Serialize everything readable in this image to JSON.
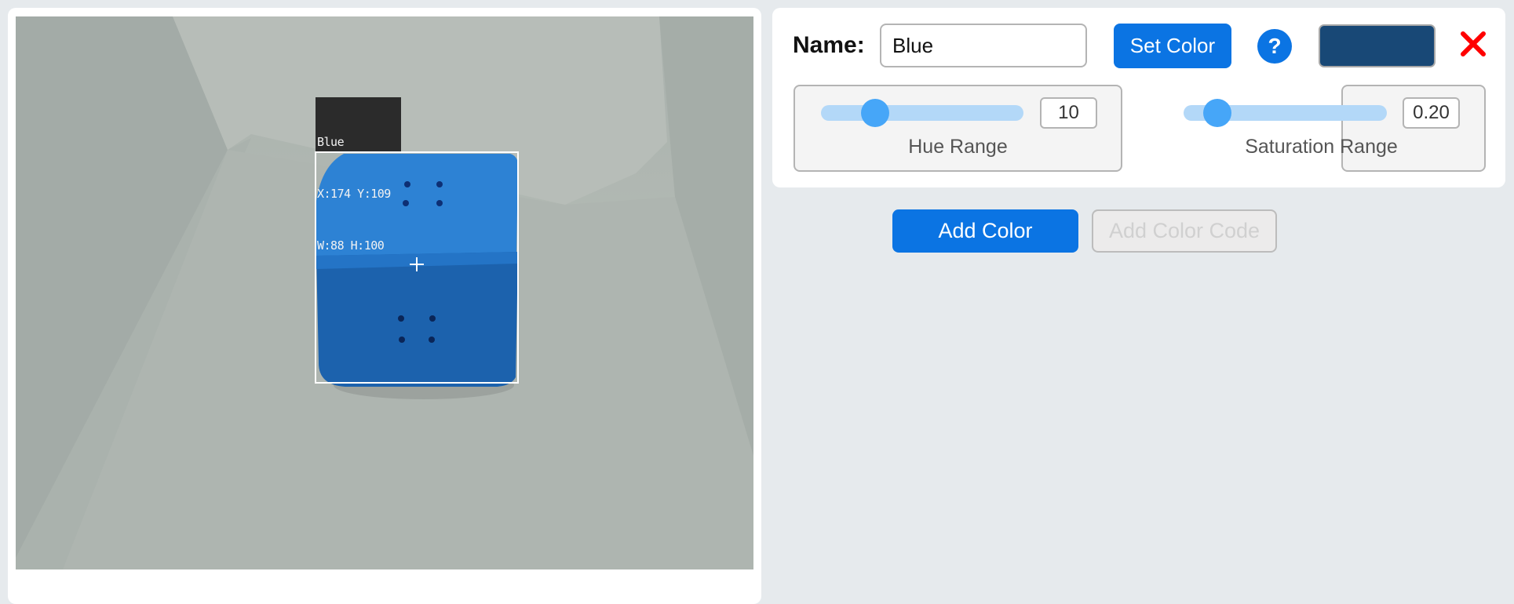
{
  "camera": {
    "detection": {
      "name": "Blue",
      "position_text": "X:174 Y:109",
      "size_text": "W:88 H:100",
      "box_color": "#ffffff",
      "object_color": "#1f6fc4"
    }
  },
  "color_editor": {
    "name_label": "Name:",
    "name_value": "Blue",
    "name_placeholder": "",
    "set_color_label": "Set Color",
    "help_icon": "question-mark",
    "swatch_color": "#184876",
    "close_icon": "x-mark",
    "hue_range": {
      "label": "Hue Range",
      "value": "10"
    },
    "saturation_range": {
      "label": "Saturation Range",
      "value": "0.20"
    }
  },
  "actions": {
    "add_color_label": "Add Color",
    "add_color_code_label": "Add Color Code"
  },
  "colors": {
    "accent": "#0b74e3",
    "close_red": "#ff0000",
    "slider_thumb": "#46a6f8",
    "slider_track": "#b3d8f8"
  }
}
